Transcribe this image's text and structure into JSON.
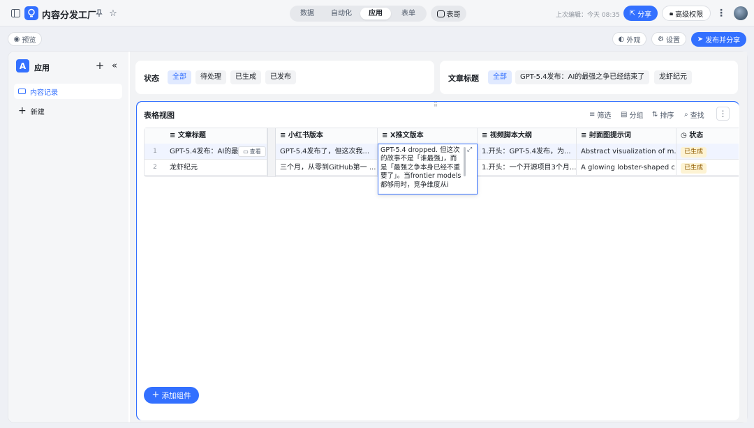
{
  "header": {
    "app_title": "内容分发工厂",
    "tabs": [
      {
        "label": "数据",
        "active": false
      },
      {
        "label": "自动化",
        "active": false
      },
      {
        "label": "应用",
        "active": true
      },
      {
        "label": "表单",
        "active": false
      }
    ],
    "assistant_label": "表哥",
    "last_edit": "上次编辑：今天 08:35",
    "share_label": "分享",
    "advanced_perm_label": "高级权限"
  },
  "subbar": {
    "preview_label": "预览",
    "appearance_label": "外观",
    "settings_label": "设置",
    "publish_label": "发布并分享"
  },
  "sidebar": {
    "title": "应用",
    "items": [
      {
        "label": "内容记录",
        "active": true
      }
    ],
    "new_label": "新建"
  },
  "filters": {
    "status": {
      "label": "状态",
      "options": [
        "全部",
        "待处理",
        "已生成",
        "已发布"
      ],
      "selected": "全部"
    },
    "title": {
      "label": "文章标题",
      "options": [
        "全部",
        "GPT-5.4发布：AI的最强之争已经结束了",
        "龙虾纪元"
      ],
      "selected": "全部"
    }
  },
  "table": {
    "title": "表格视图",
    "toolbar": {
      "filter": "筛选",
      "group": "分组",
      "sort": "排序",
      "search": "查找"
    },
    "columns": [
      "文章标题",
      "小红书版本",
      "X推文版本",
      "视频脚本大纲",
      "封面图提示词",
      "状态"
    ],
    "view_label": "查看",
    "rows": [
      {
        "index": "1",
        "title": "GPT-5.4发布：AI的最",
        "xhs": "GPT-5.4发布了，但这次我...",
        "x_post": "GPT-5.4 dropped. 但这次的故事不是「谁最强」，而是「最强之争本身已经不重要了」。当frontier models都够用时，竞争维度从i",
        "video": "1.开头：GPT-5.4发布，为...",
        "cover": "Abstract visualization of m...",
        "status": "已生成"
      },
      {
        "index": "2",
        "title": "龙虾纪元",
        "xhs": "三个月，从零到GitHub第一 ...",
        "x_post": "",
        "video": "1.开头：一个开源项目3个月...",
        "cover": "A glowing lobster-shaped c...",
        "status": "已生成"
      }
    ]
  },
  "add_component_label": "添加组件",
  "colors": {
    "accent": "#3370ff",
    "status_badge_bg": "#fdf3d3",
    "chip_active_bg": "#e1eaff"
  }
}
